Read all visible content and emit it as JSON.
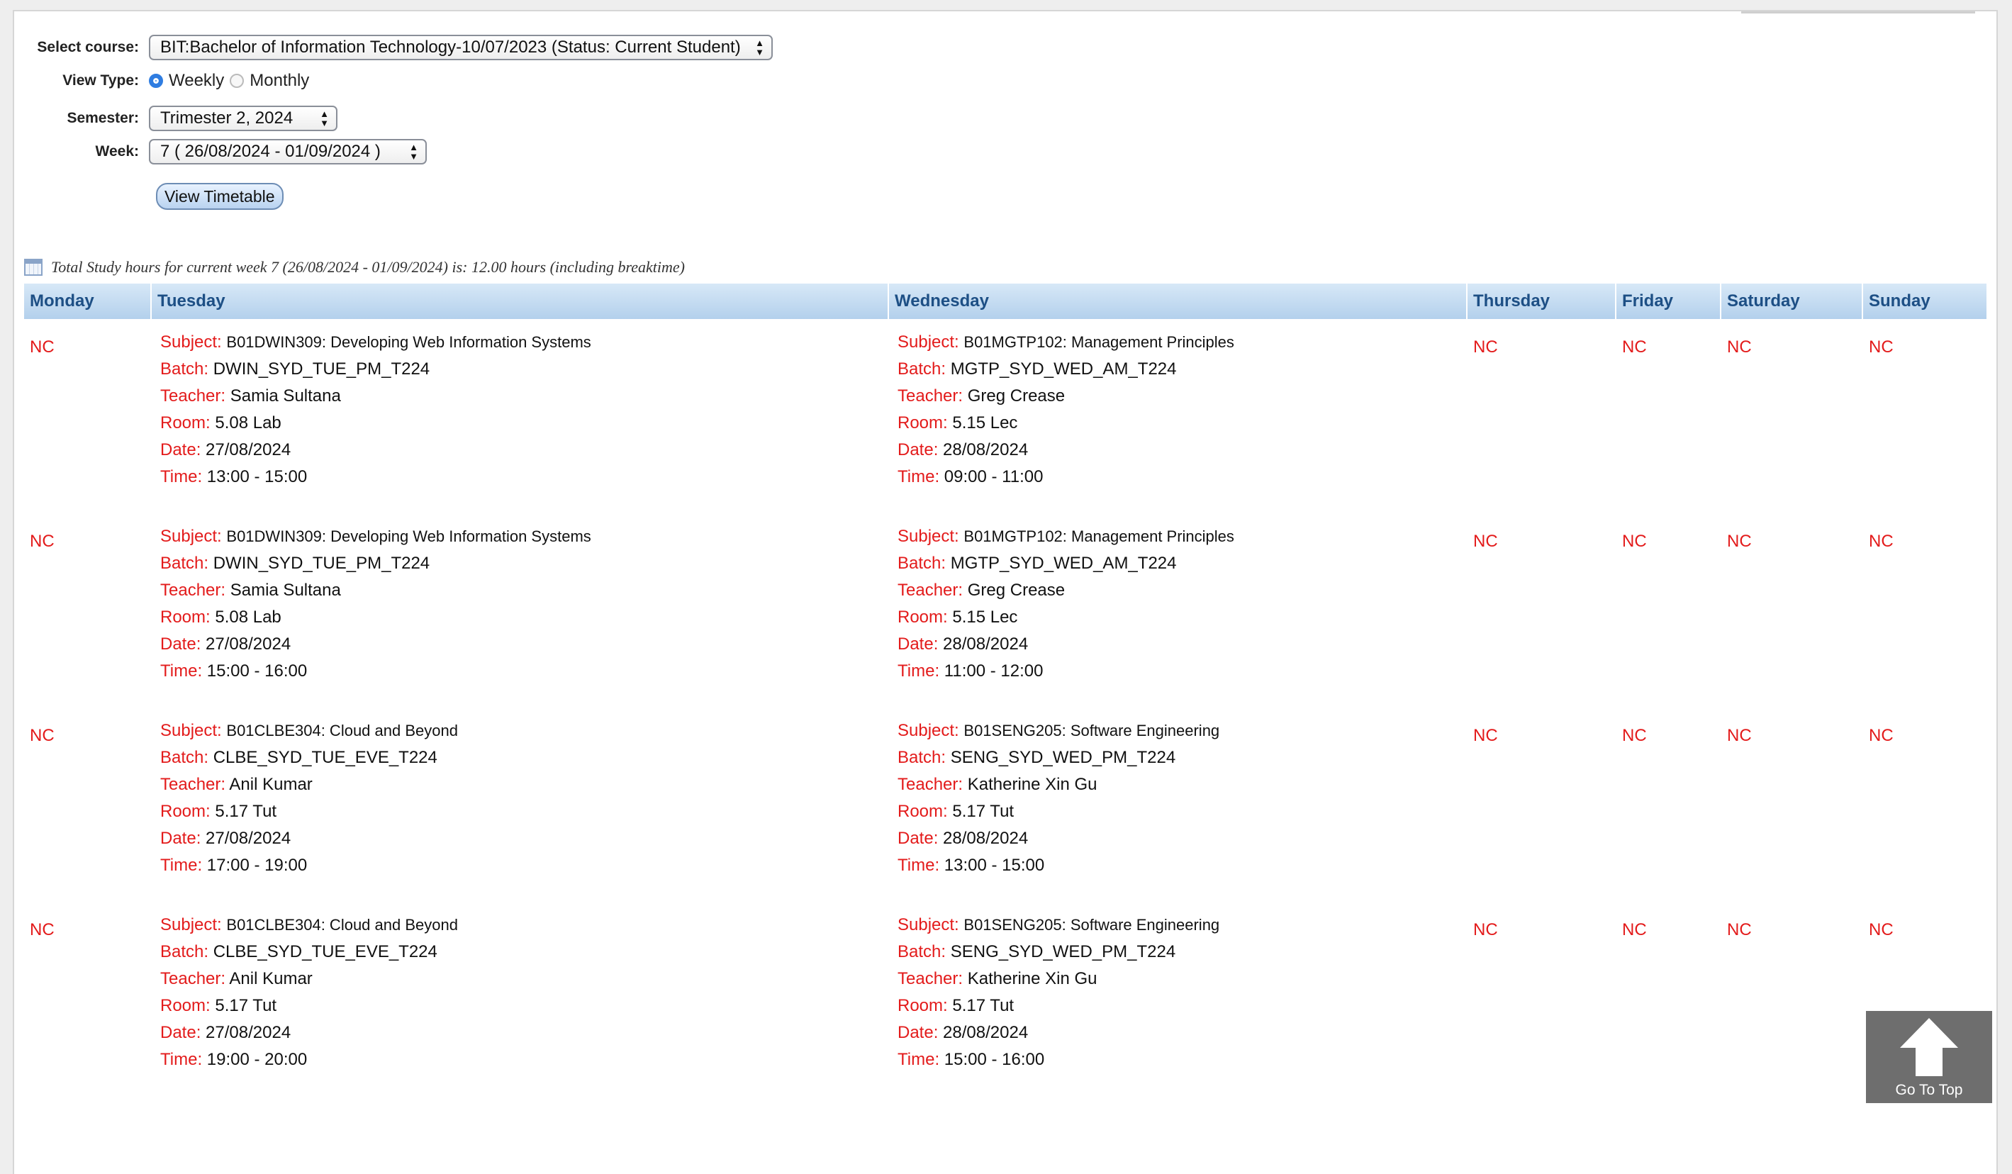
{
  "form": {
    "course_label": "Select course:",
    "course_value": "BIT:Bachelor of Information Technology-10/07/2023 (Status: Current Student)",
    "viewtype_label": "View Type:",
    "viewtype_weekly": "Weekly",
    "viewtype_monthly": "Monthly",
    "viewtype_selected": "Weekly",
    "semester_label": "Semester:",
    "semester_value": "Trimester 2, 2024",
    "week_label": "Week:",
    "week_value": "7 ( 26/08/2024 - 01/09/2024 )",
    "view_button": "View Timetable"
  },
  "summary": "Total Study hours for current week 7 (26/08/2024 - 01/09/2024) is: 12.00 hours (including breaktime)",
  "timetable": {
    "days": [
      "Monday",
      "Tuesday",
      "Wednesday",
      "Thursday",
      "Friday",
      "Saturday",
      "Sunday"
    ],
    "nc_text": "NC",
    "field_labels": {
      "subject": "Subject:",
      "batch": "Batch:",
      "teacher": "Teacher:",
      "room": "Room:",
      "date": "Date:",
      "time": "Time:"
    },
    "rows": [
      {
        "monday": "NC",
        "tuesday": {
          "subject": "B01DWIN309: Developing Web Information Systems",
          "batch": "DWIN_SYD_TUE_PM_T224",
          "teacher": "Samia Sultana",
          "room": "5.08 Lab",
          "date": "27/08/2024",
          "time": "13:00 - 15:00"
        },
        "wednesday": {
          "subject": "B01MGTP102: Management Principles",
          "batch": "MGTP_SYD_WED_AM_T224",
          "teacher": "Greg Crease",
          "room": "5.15 Lec",
          "date": "28/08/2024",
          "time": "09:00 - 11:00"
        },
        "thursday": "NC",
        "friday": "NC",
        "saturday": "NC",
        "sunday": "NC"
      },
      {
        "monday": "NC",
        "tuesday": {
          "subject": "B01DWIN309: Developing Web Information Systems",
          "batch": "DWIN_SYD_TUE_PM_T224",
          "teacher": "Samia Sultana",
          "room": "5.08 Lab",
          "date": "27/08/2024",
          "time": "15:00 - 16:00"
        },
        "wednesday": {
          "subject": "B01MGTP102: Management Principles",
          "batch": "MGTP_SYD_WED_AM_T224",
          "teacher": "Greg Crease",
          "room": "5.15 Lec",
          "date": "28/08/2024",
          "time": "11:00 - 12:00"
        },
        "thursday": "NC",
        "friday": "NC",
        "saturday": "NC",
        "sunday": "NC"
      },
      {
        "monday": "NC",
        "tuesday": {
          "subject": "B01CLBE304: Cloud and Beyond",
          "batch": "CLBE_SYD_TUE_EVE_T224",
          "teacher": "Anil Kumar",
          "room": "5.17 Tut",
          "date": "27/08/2024",
          "time": "17:00 - 19:00"
        },
        "wednesday": {
          "subject": "B01SENG205: Software Engineering",
          "batch": "SENG_SYD_WED_PM_T224",
          "teacher": "Katherine Xin Gu",
          "room": "5.17 Tut",
          "date": "28/08/2024",
          "time": "13:00 - 15:00"
        },
        "thursday": "NC",
        "friday": "NC",
        "saturday": "NC",
        "sunday": "NC"
      },
      {
        "monday": "NC",
        "tuesday": {
          "subject": "B01CLBE304: Cloud and Beyond",
          "batch": "CLBE_SYD_TUE_EVE_T224",
          "teacher": "Anil Kumar",
          "room": "5.17 Tut",
          "date": "27/08/2024",
          "time": "19:00 - 20:00"
        },
        "wednesday": {
          "subject": "B01SENG205: Software Engineering",
          "batch": "SENG_SYD_WED_PM_T224",
          "teacher": "Katherine Xin Gu",
          "room": "5.17 Tut",
          "date": "28/08/2024",
          "time": "15:00 - 16:00"
        },
        "thursday": "NC",
        "friday": "NC",
        "saturday": "NC",
        "sunday": "NC"
      }
    ]
  },
  "go_to_top": {
    "label": "Go To Top",
    "icon": "up-arrow-icon"
  }
}
